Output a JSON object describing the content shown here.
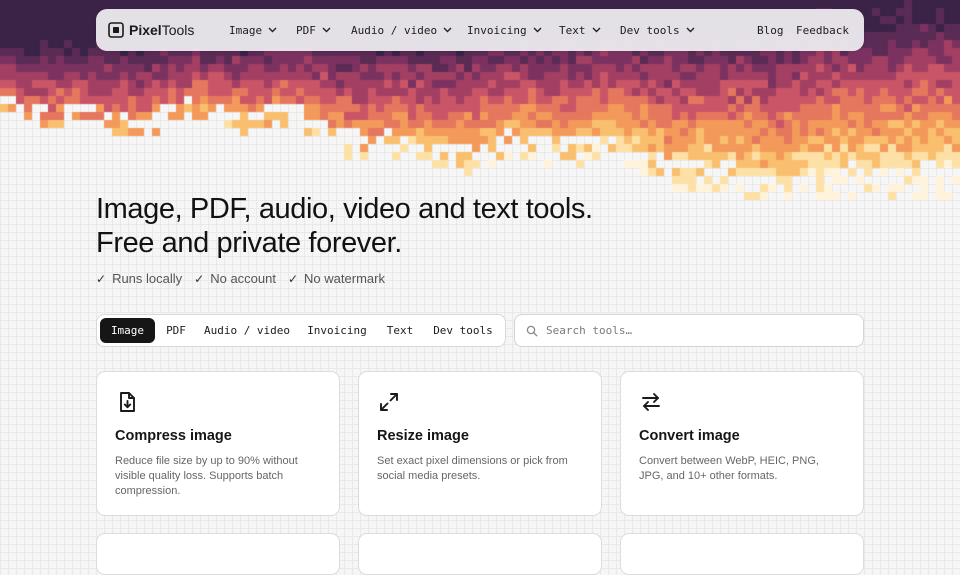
{
  "brand": {
    "name_bold": "Pixel",
    "name_light": "Tools",
    "icon": "pixel-logo-icon"
  },
  "nav": {
    "menus": [
      "Image",
      "PDF",
      "Audio / video",
      "Invoicing",
      "Text",
      "Dev tools"
    ],
    "links": [
      "Blog",
      "Feedback"
    ]
  },
  "hero": {
    "line1": "Image, PDF, audio, video and text tools.",
    "line2": "Free and private forever.",
    "badges": [
      "Runs locally",
      "No account",
      "No watermark"
    ]
  },
  "tabs": {
    "items": [
      "Image",
      "PDF",
      "Audio / video",
      "Invoicing",
      "Text",
      "Dev tools"
    ],
    "active": "Image"
  },
  "search": {
    "placeholder": "Search tools…",
    "value": ""
  },
  "cards": [
    {
      "title": "Compress image",
      "desc": "Reduce file size by up to 90% without visible quality loss. Supports batch compression.",
      "icon": "file-download-icon"
    },
    {
      "title": "Resize image",
      "desc": "Set exact pixel dimensions or pick from social media presets.",
      "icon": "expand-arrows-icon"
    },
    {
      "title": "Convert image",
      "desc": "Convert between WebP, HEIC, PNG, JPG, and 10+ other formats.",
      "icon": "swap-arrows-icon"
    }
  ],
  "colors": {
    "banner": [
      "#3a2347",
      "#5a2b55",
      "#7c3260",
      "#a23f62",
      "#c95566",
      "#e4775d",
      "#f39a5a",
      "#f9bf6e",
      "#fde0a6",
      "#fff3dc"
    ],
    "primary": "#161616"
  }
}
